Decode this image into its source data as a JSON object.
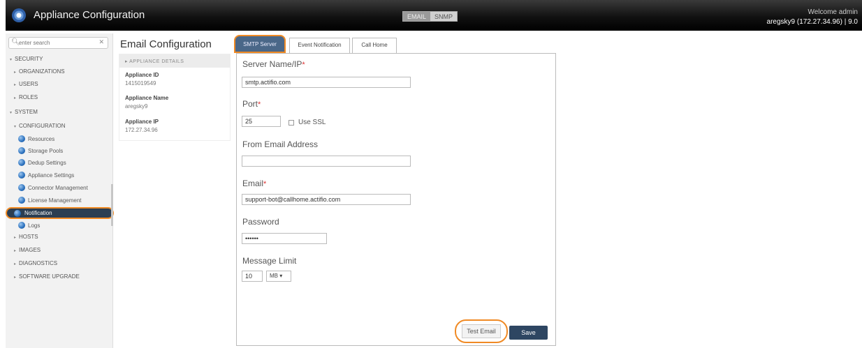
{
  "header": {
    "title": "Appliance Configuration",
    "mode_tabs": [
      {
        "label": "EMAIL"
      },
      {
        "label": "SNMP"
      }
    ],
    "welcome": "Welcome admin",
    "user_line": "aregsky9 (172.27.34.96) | 9.0"
  },
  "sidebar": {
    "search_placeholder": "enter search",
    "items": [
      {
        "label": "SECURITY"
      },
      {
        "label": "ORGANIZATIONS"
      },
      {
        "label": "USERS"
      },
      {
        "label": "ROLES"
      },
      {
        "label": "SYSTEM"
      },
      {
        "label": "CONFIGURATION"
      },
      {
        "label": "HOSTS"
      },
      {
        "label": "IMAGES"
      },
      {
        "label": "DIAGNOSTICS"
      },
      {
        "label": "SOFTWARE UPGRADE"
      }
    ],
    "leaves": [
      {
        "label": "Resources"
      },
      {
        "label": "Storage Pools"
      },
      {
        "label": "Dedup Settings"
      },
      {
        "label": "Appliance Settings"
      },
      {
        "label": "Connector Management"
      },
      {
        "label": "License Management"
      },
      {
        "label": "Notification"
      },
      {
        "label": "Logs"
      }
    ]
  },
  "details": {
    "title": "Email Configuration",
    "section": "APPLIANCE DETAILS",
    "appliance_id_label": "Appliance ID",
    "appliance_id": "1415019549",
    "appliance_name_label": "Appliance Name",
    "appliance_name": "aregsky9",
    "appliance_ip_label": "Appliance IP",
    "appliance_ip": "172.27.34.96"
  },
  "tabs": [
    {
      "label": "SMTP Server"
    },
    {
      "label": "Event Notification"
    },
    {
      "label": "Call Home"
    }
  ],
  "form": {
    "server_label": "Server Name/IP",
    "server_value": "smtp.actifio.com",
    "port_label": "Port",
    "port_value": "25",
    "ssl_label": "Use SSL",
    "from_label": "From Email Address",
    "from_value": "",
    "email_label": "Email",
    "email_value": "support-bot@callhome.actifio.com",
    "password_label": "Password",
    "password_value": "••••••",
    "limit_label": "Message Limit",
    "limit_value": "10",
    "limit_unit": "MB ▾",
    "required_mark": "*"
  },
  "buttons": {
    "test": "Test Email",
    "save": "Save"
  }
}
